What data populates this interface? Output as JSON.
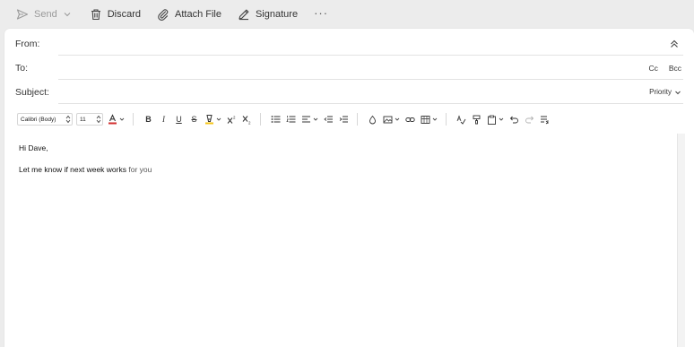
{
  "toolbar": {
    "send_label": "Send",
    "discard_label": "Discard",
    "attach_label": "Attach File",
    "signature_label": "Signature",
    "more_label": "···"
  },
  "fields": {
    "from_label": "From:",
    "to_label": "To:",
    "subject_label": "Subject:",
    "from_value": "",
    "to_value": "",
    "subject_value": "",
    "cc_label": "Cc",
    "bcc_label": "Bcc",
    "priority_label": "Priority"
  },
  "format": {
    "font_name": "Calibri (Body)",
    "font_size": "11",
    "font_color": "#d32f2f",
    "highlight_color": "#f5c518"
  },
  "message": {
    "line1": "Hi Dave,",
    "line2_main": "Let me know if next week works",
    "line2_tail": " for you"
  }
}
